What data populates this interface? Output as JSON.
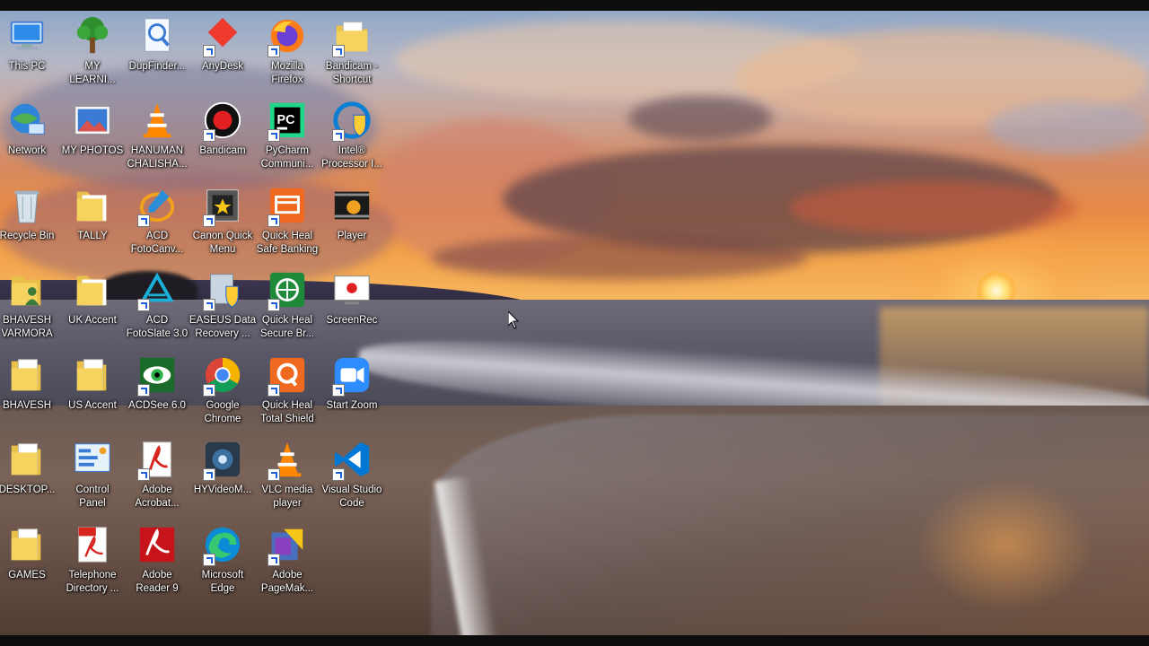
{
  "desktop": {
    "icons": [
      {
        "label": "This PC",
        "icon": "this-pc-icon"
      },
      {
        "label": "MY\nLEARNI...",
        "icon": "tree-icon"
      },
      {
        "label": "DupFinder...",
        "icon": "magnifier-document-icon"
      },
      {
        "label": "AnyDesk",
        "icon": "anydesk-icon"
      },
      {
        "label": "Mozilla\nFirefox",
        "icon": "firefox-icon"
      },
      {
        "label": "Bandicam -\nShortcut",
        "icon": "folder-document-icon"
      },
      {
        "label": "Network",
        "icon": "network-icon"
      },
      {
        "label": "MY PHOTOS",
        "icon": "photo-icon"
      },
      {
        "label": "HANUMAN\nCHALISHA...",
        "icon": "vlc-cone-icon"
      },
      {
        "label": "Bandicam",
        "icon": "bandicam-icon"
      },
      {
        "label": "PyCharm\nCommuni...",
        "icon": "pycharm-icon"
      },
      {
        "label": "Intel®\nProcessor I...",
        "icon": "intel-shield-icon"
      },
      {
        "label": "Recycle Bin",
        "icon": "recycle-bin-icon"
      },
      {
        "label": "TALLY",
        "icon": "folder-icon"
      },
      {
        "label": "ACD\nFotoCanv...",
        "icon": "acd-fotocanvas-icon"
      },
      {
        "label": "Canon Quick\nMenu",
        "icon": "canon-quick-menu-icon"
      },
      {
        "label": "Quick Heal\nSafe Banking",
        "icon": "quickheal-banking-icon"
      },
      {
        "label": "Player",
        "icon": "media-player-icon"
      },
      {
        "label": "BHAVESH\nVARMORA",
        "icon": "user-folder-icon"
      },
      {
        "label": "UK Accent",
        "icon": "folder-icon"
      },
      {
        "label": "ACD\nFotoSlate 3.0",
        "icon": "acd-fotoslate-icon"
      },
      {
        "label": "EASEUS Data\nRecovery ...",
        "icon": "easeus-icon"
      },
      {
        "label": "Quick Heal\nSecure Br...",
        "icon": "quickheal-browser-icon"
      },
      {
        "label": "ScreenRec",
        "icon": "screenrec-icon"
      },
      {
        "label": "BHAVESH",
        "icon": "folder-document-icon"
      },
      {
        "label": "US Accent",
        "icon": "folder-document-icon"
      },
      {
        "label": "ACDSee 6.0",
        "icon": "acdsee-eye-icon"
      },
      {
        "label": "Google\nChrome",
        "icon": "chrome-icon"
      },
      {
        "label": "Quick Heal\nTotal Shield",
        "icon": "quickheal-shield-icon"
      },
      {
        "label": "Start Zoom",
        "icon": "zoom-icon"
      },
      {
        "label": "DESKTOP...",
        "icon": "folder-document-icon"
      },
      {
        "label": "Control\nPanel",
        "icon": "control-panel-icon"
      },
      {
        "label": "Adobe\nAcrobat...",
        "icon": "acrobat-icon"
      },
      {
        "label": "HYVideoM...",
        "icon": "hyvideo-icon"
      },
      {
        "label": "VLC media\nplayer",
        "icon": "vlc-cone-icon"
      },
      {
        "label": "Visual Studio\nCode",
        "icon": "vscode-icon"
      },
      {
        "label": "GAMES",
        "icon": "folder-document-icon"
      },
      {
        "label": "Telephone\nDirectory ...",
        "icon": "pdf-document-icon"
      },
      {
        "label": "Adobe\nReader 9",
        "icon": "adobe-reader-icon"
      },
      {
        "label": "Microsoft\nEdge",
        "icon": "edge-icon"
      },
      {
        "label": "Adobe\nPageMak...",
        "icon": "pagemaker-icon"
      }
    ]
  }
}
